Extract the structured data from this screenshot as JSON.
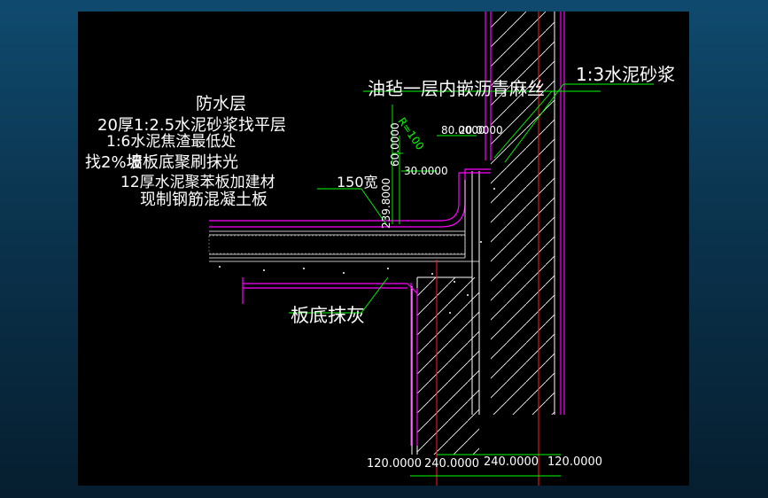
{
  "colors": {
    "background": "#000000",
    "frame": "#0b3550",
    "structure_line": "#ffffff",
    "membrane": "#ff00ff",
    "axis": "#ff2020",
    "dimension": "#00ff00",
    "leader": "#00ff00",
    "label": "#ffffff"
  },
  "labels": {
    "waterproof_layer": "防水层",
    "screed_20": "20厚1:2.5水泥砂浆找平层",
    "slag_min": "1:6水泥焦渣最低处",
    "slope_note": "找2%坡",
    "slab_finish": "墙板底聚刷抹光",
    "insulation_12": "12厚水泥聚苯板加建材",
    "width_150": "150宽",
    "rc_slab": "现制钢筋混凝土板",
    "felt_layer": "油毡一层内嵌沥青麻丝",
    "cement_mortar": "1:3水泥砂浆",
    "ceiling_plaster": "板底抹灰"
  },
  "dimensions": {
    "d80_1": "80.0000",
    "d20_1": "20.0000",
    "d30": "30.0000",
    "vert_a": "239.8000",
    "vert_b": "60.0000",
    "radius": "R=100",
    "bottom_120_left": "120.0000",
    "bottom_240_left": "240.0000",
    "bottom_240_right": "240.0000",
    "bottom_120_right": "120.0000"
  }
}
